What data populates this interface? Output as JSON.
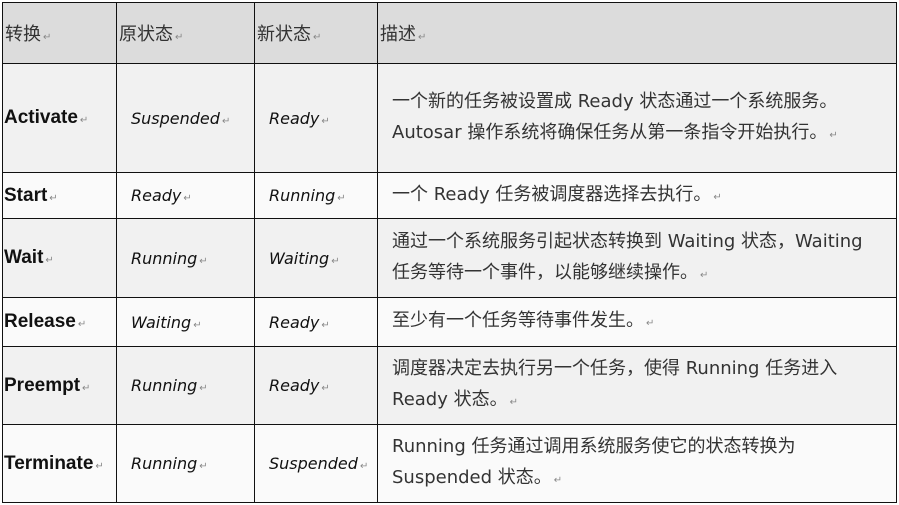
{
  "table": {
    "headers": [
      "转换",
      "原状态",
      "新状态",
      "描述"
    ],
    "rows": [
      {
        "transition": "Activate",
        "from": "Suspended",
        "to": "Ready",
        "description": "一个新的任务被设置成 Ready 状态通过一个系统服务。Autosar 操作系统将确保任务从第一条指令开始执行。"
      },
      {
        "transition": "Start",
        "from": "Ready",
        "to": "Running",
        "description": "一个 Ready 任务被调度器选择去执行。"
      },
      {
        "transition": "Wait",
        "from": "Running",
        "to": "Waiting",
        "description": "通过一个系统服务引起状态转换到 Waiting 状态，Waiting 任务等待一个事件，以能够继续操作。"
      },
      {
        "transition": "Release",
        "from": "Waiting",
        "to": "Ready",
        "description": "至少有一个任务等待事件发生。"
      },
      {
        "transition": "Preempt",
        "from": "Running",
        "to": "Ready",
        "description": "调度器决定去执行另一个任务，使得 Running 任务进入 Ready 状态。"
      },
      {
        "transition": "Terminate",
        "from": "Running",
        "to": "Suspended",
        "description": "Running 任务通过调用系统服务使它的状态转换为 Suspended 状态。"
      }
    ]
  },
  "paragraph_mark": "↵"
}
